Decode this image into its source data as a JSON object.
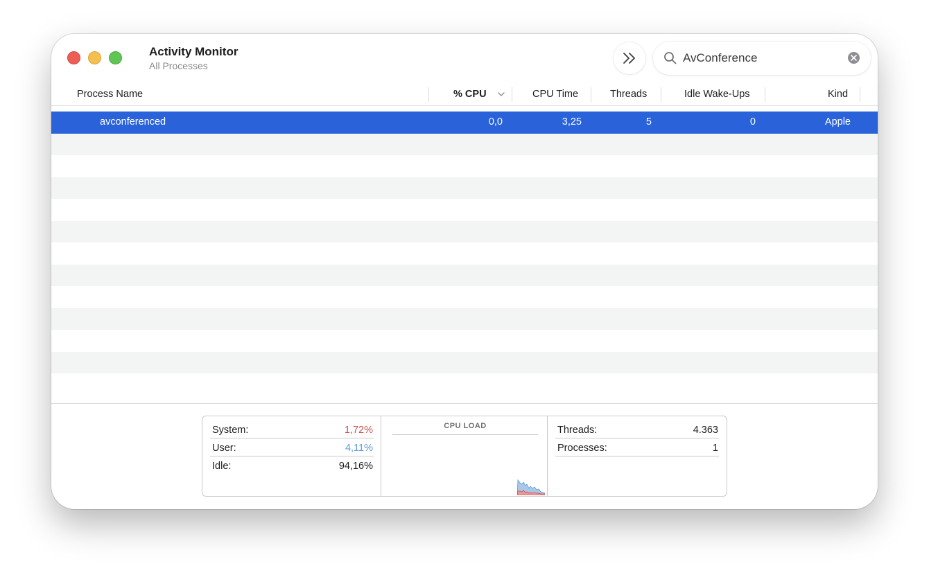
{
  "window": {
    "title": "Activity Monitor",
    "subtitle": "All Processes"
  },
  "search": {
    "value": "AvConference",
    "icon": "magnifying-glass-icon"
  },
  "toolbar": {
    "expand_icon": "double-chevron-right-icon"
  },
  "table": {
    "columns": [
      "Process Name",
      "% CPU",
      "CPU Time",
      "Threads",
      "Idle Wake-Ups",
      "Kind"
    ],
    "sorted_column": "% CPU",
    "sort_direction": "descending",
    "rows": [
      {
        "process_name": "avconferenced",
        "cpu_percent": "0,0",
        "cpu_time": "3,25",
        "threads": "5",
        "idle_wake_ups": "0",
        "kind": "Apple",
        "selected": true
      }
    ]
  },
  "stats": {
    "system_label": "System:",
    "system_value": "1,72%",
    "user_label": "User:",
    "user_value": "4,11%",
    "idle_label": "Idle:",
    "idle_value": "94,16%",
    "cpu_load_title": "CPU LOAD",
    "threads_label": "Threads:",
    "threads_value": "4.363",
    "processes_label": "Processes:",
    "processes_value": "1"
  },
  "colors": {
    "selection": "#2962d9",
    "system": "#d0504e",
    "user": "#5b9bd5",
    "close": "#ed5e59",
    "minimize": "#f5bf4f",
    "maximize": "#61c554"
  }
}
